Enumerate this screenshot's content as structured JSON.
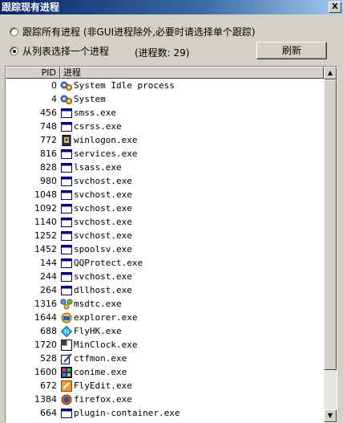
{
  "window": {
    "title": "跟踪现有进程",
    "close_label": "X"
  },
  "options": {
    "trace_all": "跟踪所有进程 (非GUI进程除外,必要时请选择单个跟踪)",
    "select_from_list": "从列表选择一个进程",
    "process_count": "(进程数: 29)",
    "refresh_button": "刷新"
  },
  "list": {
    "columns": {
      "pid": "PID",
      "process": "进程"
    },
    "rows": [
      {
        "pid": "0",
        "name": "System Idle process",
        "icon": "system-gear-icon"
      },
      {
        "pid": "4",
        "name": "System",
        "icon": "system-gear-icon"
      },
      {
        "pid": "456",
        "name": "smss.exe",
        "icon": "window-icon"
      },
      {
        "pid": "748",
        "name": "csrss.exe",
        "icon": "window-icon"
      },
      {
        "pid": "772",
        "name": "winlogon.exe",
        "icon": "winlogon-icon"
      },
      {
        "pid": "816",
        "name": "services.exe",
        "icon": "window-icon"
      },
      {
        "pid": "828",
        "name": "lsass.exe",
        "icon": "window-icon"
      },
      {
        "pid": "980",
        "name": "svchost.exe",
        "icon": "window-icon"
      },
      {
        "pid": "1048",
        "name": "svchost.exe",
        "icon": "window-icon"
      },
      {
        "pid": "1092",
        "name": "svchost.exe",
        "icon": "window-icon"
      },
      {
        "pid": "1140",
        "name": "svchost.exe",
        "icon": "window-icon"
      },
      {
        "pid": "1252",
        "name": "svchost.exe",
        "icon": "window-icon"
      },
      {
        "pid": "1452",
        "name": "spoolsv.exe",
        "icon": "window-icon"
      },
      {
        "pid": "144",
        "name": "QQProtect.exe",
        "icon": "window-icon"
      },
      {
        "pid": "244",
        "name": "svchost.exe",
        "icon": "window-icon"
      },
      {
        "pid": "264",
        "name": "dllhost.exe",
        "icon": "window-icon"
      },
      {
        "pid": "1316",
        "name": "msdtc.exe",
        "icon": "msdtc-icon"
      },
      {
        "pid": "1644",
        "name": "explorer.exe",
        "icon": "explorer-icon"
      },
      {
        "pid": "688",
        "name": "FlyHK.exe",
        "icon": "flyhk-icon"
      },
      {
        "pid": "1720",
        "name": "MinClock.exe",
        "icon": "minclock-icon"
      },
      {
        "pid": "528",
        "name": "ctfmon.exe",
        "icon": "ctfmon-icon"
      },
      {
        "pid": "1600",
        "name": "conime.exe",
        "icon": "conime-icon"
      },
      {
        "pid": "672",
        "name": "FlyEdit.exe",
        "icon": "flyedit-icon"
      },
      {
        "pid": "1384",
        "name": "firefox.exe",
        "icon": "firefox-icon"
      },
      {
        "pid": "664",
        "name": "plugin-container.exe",
        "icon": "window-icon"
      }
    ]
  }
}
